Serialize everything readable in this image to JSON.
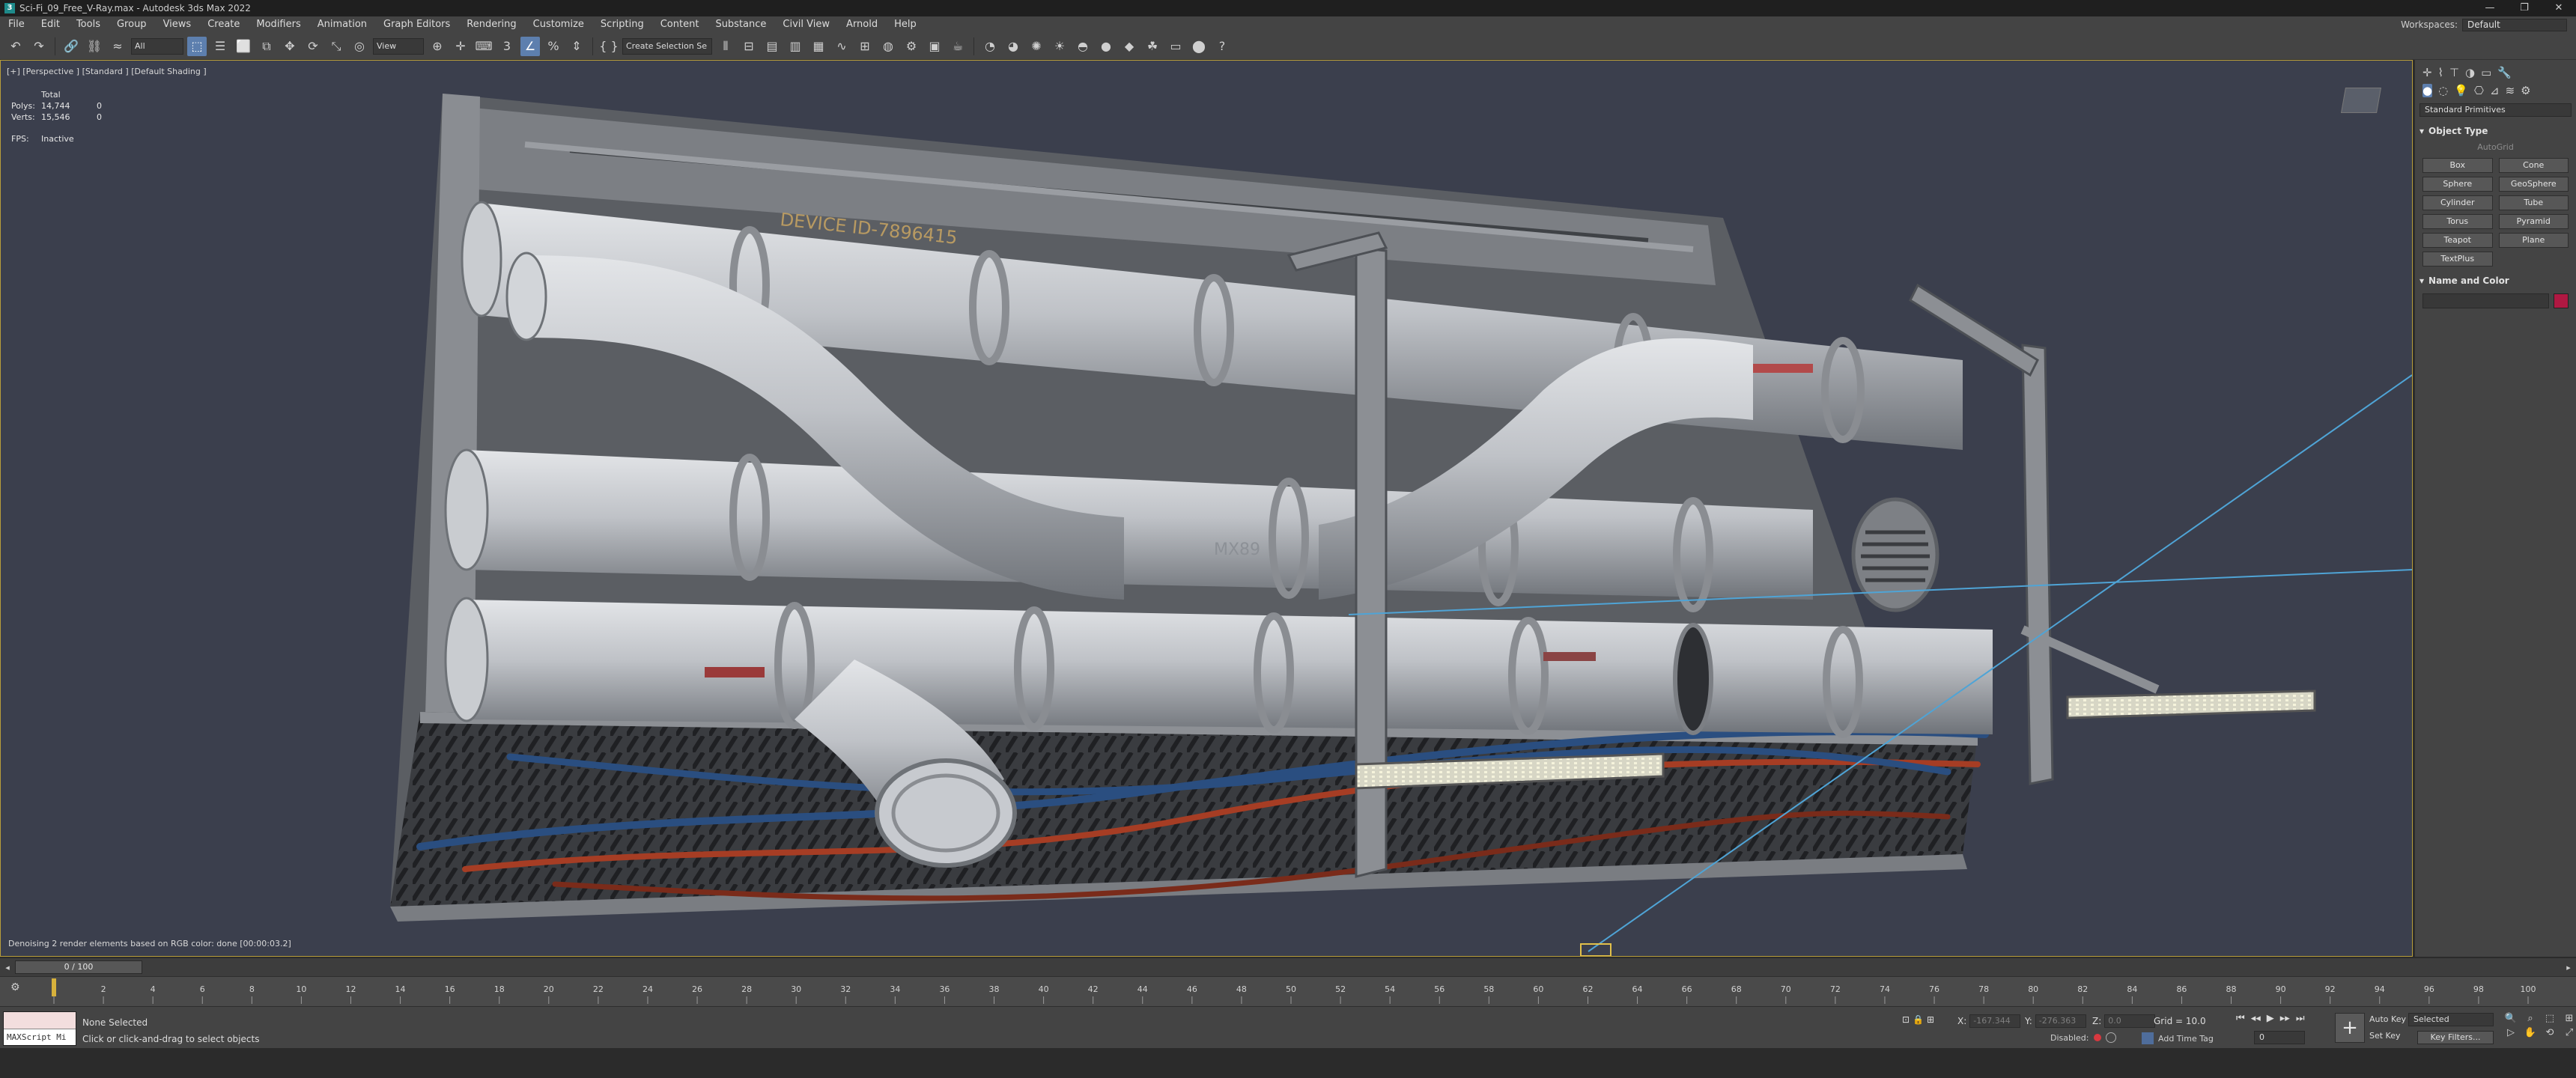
{
  "window": {
    "title": "Sci-Fi_09_Free_V-Ray.max - Autodesk 3ds Max 2022",
    "icon_text": "3",
    "controls": [
      "—",
      "❐",
      "✕"
    ]
  },
  "menubar": {
    "items": [
      "File",
      "Edit",
      "Tools",
      "Group",
      "Views",
      "Create",
      "Modifiers",
      "Animation",
      "Graph Editors",
      "Rendering",
      "Customize",
      "Scripting",
      "Content",
      "Substance",
      "Civil View",
      "Arnold",
      "Help"
    ],
    "workspace_label": "Workspaces:",
    "workspace_value": "Default"
  },
  "toolbar": {
    "filter_dropdown": "All",
    "refcoord_dropdown": "View",
    "named_selection": "Create Selection Se",
    "snap_label": "3"
  },
  "viewport": {
    "label": "[+] [Perspective ] [Standard ] [Default Shading ]",
    "stats": {
      "header": "Total",
      "rows": [
        {
          "key": "Polys:",
          "total": "14,744",
          "sel": "0"
        },
        {
          "key": "Verts:",
          "total": "15,546",
          "sel": "0"
        }
      ],
      "fps_label": "FPS:",
      "fps_value": "Inactive"
    },
    "scene_texts": {
      "device_id": "DEVICE ID-7896415",
      "mx_text": "MX89"
    },
    "status_message": "Denoising 2 render elements based on RGB color: done [00:00:03.2]",
    "colors": {
      "background": "#3b3f4d",
      "frame": "#b89d3a",
      "pipe": "#b9bcc1",
      "cable_blue": "#2a4e80",
      "cable_red": "#a63d24"
    }
  },
  "command_panel": {
    "category_dropdown": "Standard Primitives",
    "object_type_title": "Object Type",
    "autogrid_label": "AutoGrid",
    "primitives": [
      "Box",
      "Cone",
      "Sphere",
      "GeoSphere",
      "Cylinder",
      "Tube",
      "Torus",
      "Pyramid",
      "Teapot",
      "Plane",
      "TextPlus"
    ],
    "name_color_title": "Name and Color",
    "object_color": "#b01842"
  },
  "timeline": {
    "frame_display": "0 / 100",
    "ticks": [
      "0",
      "2",
      "4",
      "6",
      "8",
      "10",
      "12",
      "14",
      "16",
      "18",
      "20",
      "22",
      "24",
      "26",
      "28",
      "30",
      "32",
      "34",
      "36",
      "38",
      "40",
      "42",
      "44",
      "46",
      "48",
      "50",
      "52",
      "54",
      "56",
      "58",
      "60",
      "62",
      "64",
      "66",
      "68",
      "70",
      "72",
      "74",
      "76",
      "78",
      "80",
      "82",
      "84",
      "86",
      "88",
      "90",
      "92",
      "94",
      "96",
      "98",
      "100"
    ]
  },
  "status": {
    "maxscript_label": "MAXScript Mi",
    "selection": "None Selected",
    "prompt": "Click or click-and-drag to select objects",
    "x_label": "X:",
    "x_value": "-167.344",
    "y_label": "Y:",
    "y_value": "-276.363",
    "z_label": "Z:",
    "z_value": "0.0",
    "grid": "Grid = 10.0",
    "disabled_label": "Disabled:",
    "add_time_tag": "Add Time Tag",
    "auto_key": "Auto Key",
    "set_key": "Set Key",
    "selected_dropdown": "Selected",
    "key_filters": "Key Filters...",
    "current_frame": "0"
  }
}
